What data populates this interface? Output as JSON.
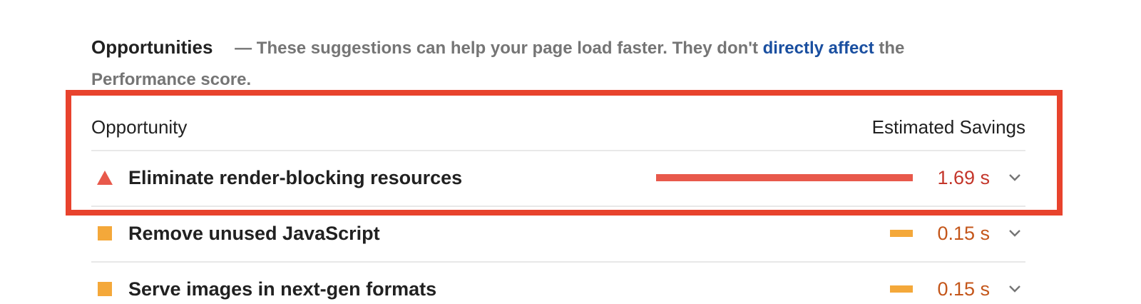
{
  "section": {
    "title": "Opportunities",
    "description_prefix": "— These suggestions can help your page load faster. They don't ",
    "link_text": "directly affect",
    "description_suffix": " the Performance score."
  },
  "table": {
    "column_opportunity": "Opportunity",
    "column_savings": "Estimated Savings"
  },
  "audits": [
    {
      "title": "Eliminate render-blocking resources",
      "savings": "1.69 s",
      "severity": "fail",
      "bar_fraction": 1.0,
      "color": "#e8594b",
      "highlighted": true
    },
    {
      "title": "Remove unused JavaScript",
      "savings": "0.15 s",
      "severity": "average",
      "bar_fraction": 0.09,
      "color": "#f4a83a",
      "highlighted": false
    },
    {
      "title": "Serve images in next-gen formats",
      "savings": "0.15 s",
      "severity": "average",
      "bar_fraction": 0.09,
      "color": "#f4a83a",
      "highlighted": false
    }
  ],
  "colors": {
    "highlight_border": "#e8432d",
    "link": "#1a4fa0",
    "fail": "#e8594b",
    "average": "#f4a83a"
  },
  "icons": {
    "fail": "warning-triangle-icon",
    "average": "average-square-icon",
    "expand": "chevron-down-icon"
  }
}
